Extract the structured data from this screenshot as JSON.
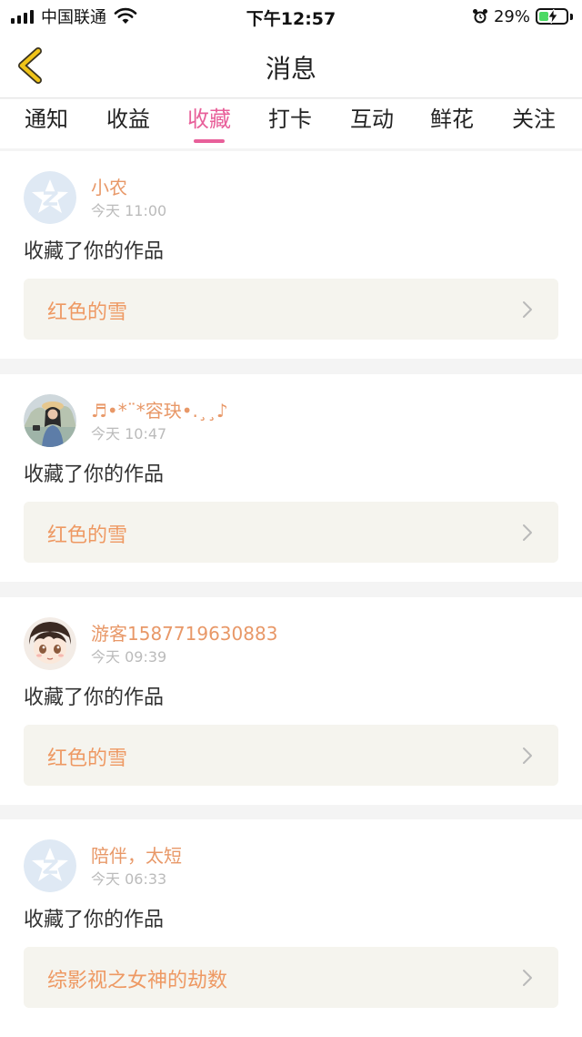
{
  "status_bar": {
    "carrier": "中国联通",
    "time": "下午12:57",
    "battery_percent": "29%",
    "icons": [
      "signal-icon",
      "wifi-icon",
      "alarm-icon",
      "battery-icon"
    ]
  },
  "header": {
    "title": "消息",
    "back_icon": "chevron-left-icon"
  },
  "tabs": [
    {
      "label": "通知"
    },
    {
      "label": "收益"
    },
    {
      "label": "收藏"
    },
    {
      "label": "打卡"
    },
    {
      "label": "互动"
    },
    {
      "label": "鲜花"
    },
    {
      "label": "关注"
    }
  ],
  "active_tab": "收藏",
  "messages": [
    {
      "username": "小农",
      "time": "今天 11:00",
      "action": "收藏了你的作品",
      "work_title": "红色的雪",
      "avatar": "default-avatar"
    },
    {
      "username": "♬•*¨*容玦•.¸¸♪",
      "time": "今天 10:47",
      "action": "收藏了你的作品",
      "work_title": "红色的雪",
      "avatar": "photo-avatar"
    },
    {
      "username": "游客1587719630883",
      "time": "今天 09:39",
      "action": "收藏了你的作品",
      "work_title": "红色的雪",
      "avatar": "anime-avatar"
    },
    {
      "username": "陪伴，太短",
      "time": "今天 06:33",
      "action": "收藏了你的作品",
      "work_title": "综影视之女神的劫数",
      "avatar": "default-avatar"
    }
  ],
  "colors": {
    "accent_pink": "#e8609a",
    "username_orange": "#e89868",
    "work_title_orange": "#ee9963",
    "work_box_bg": "#f5f4ee",
    "back_arrow_yellow": "#f0c419"
  }
}
